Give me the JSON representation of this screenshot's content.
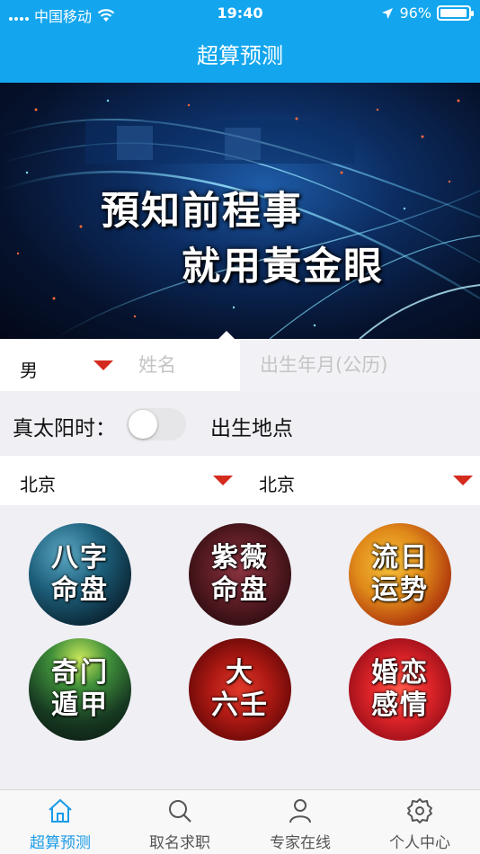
{
  "status_bar": {
    "carrier": "中国移动",
    "time": "19:40",
    "battery": "96%",
    "battery_level": 0.96
  },
  "nav": {
    "title": "超算预测"
  },
  "banner": {
    "line1": "預知前程事",
    "line2": "就用黃金眼"
  },
  "form": {
    "gender": "男",
    "name_placeholder": "姓名",
    "birth_placeholder": "出生年月(公历)",
    "solar_time_label": "真太阳时：",
    "solar_time_on": false,
    "birthplace_label": "出生地点",
    "province": "北京",
    "city": "北京"
  },
  "features": [
    {
      "line1": "八字",
      "line2": "命盘"
    },
    {
      "line1": "紫薇",
      "line2": "命盘"
    },
    {
      "line1": "流日",
      "line2": "运势"
    },
    {
      "line1": "奇门",
      "line2": "遁甲"
    },
    {
      "line1": "大",
      "line2": "六壬"
    },
    {
      "line1": "婚恋",
      "line2": "感情"
    }
  ],
  "tabs": [
    {
      "label": "超算预测",
      "icon": "home-icon",
      "active": true
    },
    {
      "label": "取名求职",
      "icon": "search-icon",
      "active": false
    },
    {
      "label": "专家在线",
      "icon": "person-icon",
      "active": false
    },
    {
      "label": "个人中心",
      "icon": "gear-icon",
      "active": false
    }
  ],
  "colors": {
    "primary": "#13a6ee",
    "active_tab": "#1a9be8",
    "dropdown_arrow": "#d42b1e"
  }
}
